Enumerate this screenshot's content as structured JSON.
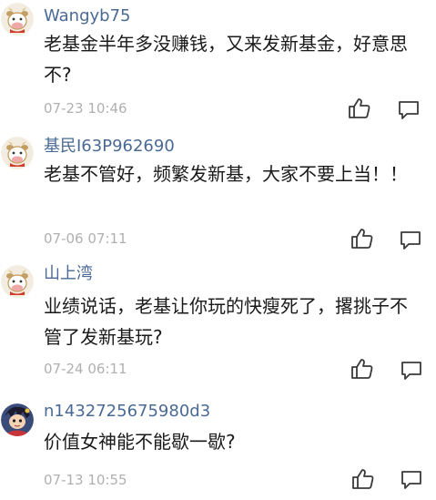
{
  "comments": [
    {
      "username": "Wangyb75",
      "text": "老基金半年多没赚钱，又来发新基金，好意思不?",
      "time": "07-23 10:46",
      "avatar_icon": "cartoon-cow-avatar"
    },
    {
      "username": "基民I63P962690",
      "text": "老基不管好，频繁发新基，大家不要上当！！",
      "time": "07-06 07:11",
      "avatar_icon": "cartoon-cow-avatar"
    },
    {
      "username": "山上湾",
      "text": "业绩说话，老基让你玩的快瘦死了，撂挑子不管了发新基玩?",
      "time": "07-24 06:11",
      "avatar_icon": "cartoon-cow-avatar"
    },
    {
      "username": "n1432725675980d3",
      "text": "价值女神能不能歇一歇?",
      "time": "07-13 10:55",
      "avatar_icon": "anime-character-avatar"
    }
  ],
  "icons": {
    "like": "thumbs-up-icon",
    "reply": "comment-bubble-icon"
  },
  "colors": {
    "username": "#4a6a95",
    "text": "#1a1a1a",
    "timestamp": "#b0b0b0",
    "icon": "#3a3a3a"
  }
}
